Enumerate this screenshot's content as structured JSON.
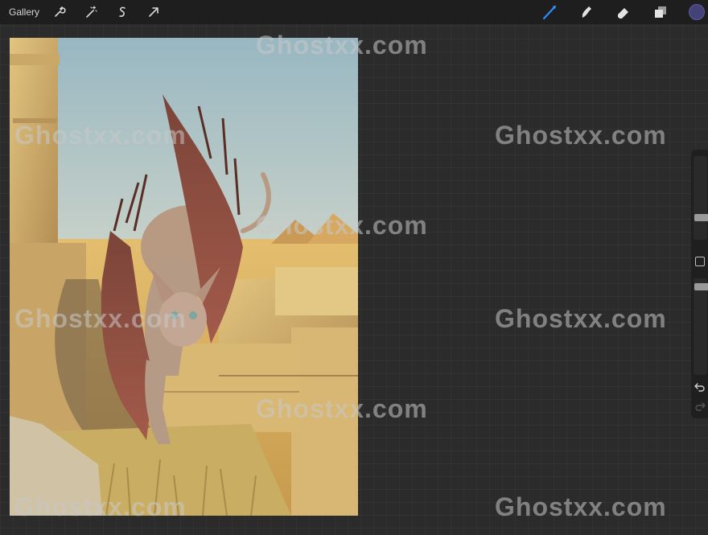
{
  "topbar": {
    "gallery_label": "Gallery",
    "left_tools": [
      "wrench-icon",
      "magic-wand-icon",
      "selection-icon",
      "transform-arrow-icon"
    ],
    "right_tools": [
      "brush-icon",
      "smudge-icon",
      "eraser-icon",
      "layers-icon"
    ],
    "active_tool": "brush",
    "current_color": "#43437a"
  },
  "sidebar": {
    "brush_size_level": 0.72,
    "opacity_level": 0.05
  },
  "watermarks": [
    "Ghostxx.com",
    "Ghostxx.com",
    "Ghostxx.com",
    "Ghostxx.com",
    "Ghostxx.com",
    "Ghostxx.com",
    "Ghostxx.com",
    "Ghostxx.com",
    "Ghostxx.com"
  ]
}
